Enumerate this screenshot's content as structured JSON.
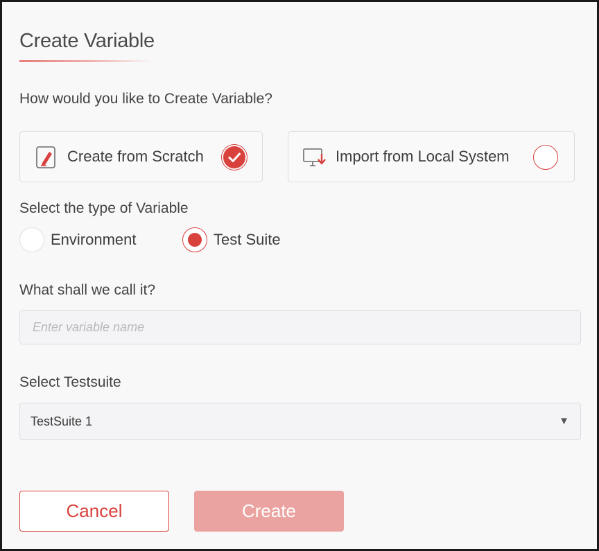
{
  "dialog": {
    "title": "Create Variable",
    "how_question": "How would you like to Create Variable?",
    "options": [
      {
        "label": "Create from Scratch",
        "icon": "edit-document-icon",
        "selected": true
      },
      {
        "label": "Import from Local System",
        "icon": "monitor-download-icon",
        "selected": false
      }
    ],
    "type_question": "Select the type of Variable",
    "variable_types": [
      {
        "label": "Environment",
        "selected": false
      },
      {
        "label": "Test Suite",
        "selected": true
      }
    ],
    "name_question": "What shall we call it?",
    "name_input": {
      "value": "",
      "placeholder": "Enter variable name"
    },
    "testsuite_question": "Select Testsuite",
    "testsuite_select": {
      "value": "TestSuite 1"
    },
    "cancel_label": "Cancel",
    "create_label": "Create"
  },
  "colors": {
    "accent": "#d9413d",
    "accent_disabled": "#eaa3a0",
    "background": "#f8f8f9"
  }
}
